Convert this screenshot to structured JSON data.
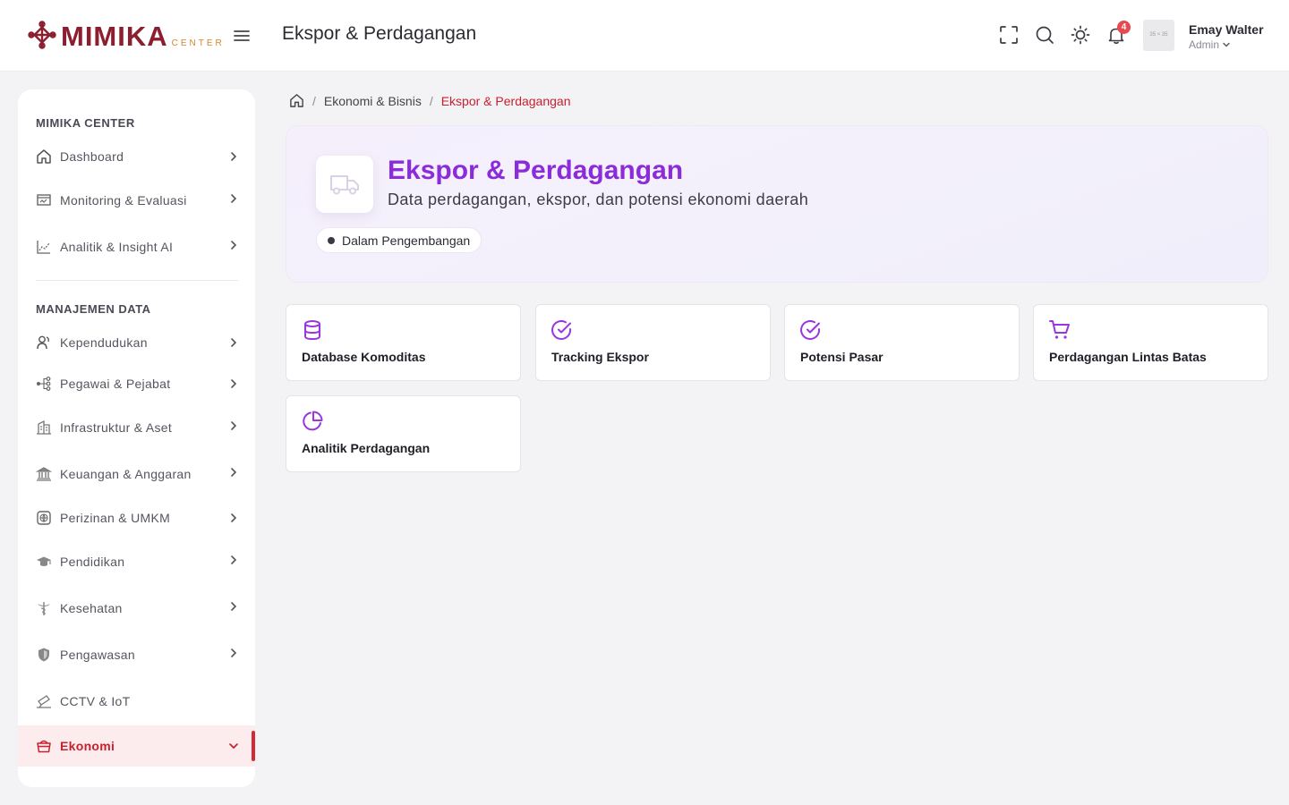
{
  "header": {
    "logo_text": "MIMIKA",
    "logo_sub": "CENTER",
    "title": "Ekspor & Perdagangan",
    "notification_count": "4",
    "avatar_placeholder": "35 × 35",
    "user_name": "Emay Walter",
    "user_role": "Admin",
    "icons": [
      "fullscreen-icon",
      "search-icon",
      "theme-sun-icon",
      "bell-icon"
    ]
  },
  "sidebar": {
    "section1": "MIMIKA CENTER",
    "section2": "MANAJEMEN DATA",
    "items1": [
      {
        "label": "Dashboard",
        "icon": "home-icon"
      },
      {
        "label": "Monitoring & Evaluasi",
        "icon": "monitor-icon"
      },
      {
        "label": "Analitik & Insight AI",
        "icon": "chart-icon"
      }
    ],
    "items2": [
      {
        "label": "Kependudukan",
        "icon": "users-icon"
      },
      {
        "label": "Pegawai & Pejabat",
        "icon": "org-chart-icon"
      },
      {
        "label": "Infrastruktur & Aset",
        "icon": "building-icon"
      },
      {
        "label": "Keuangan & Anggaran",
        "icon": "bank-icon"
      },
      {
        "label": "Perizinan & UMKM",
        "icon": "license-icon"
      },
      {
        "label": "Pendidikan",
        "icon": "graduation-cap-icon"
      },
      {
        "label": "Kesehatan",
        "icon": "caduceus-icon"
      },
      {
        "label": "Pengawasan",
        "icon": "shield-icon"
      },
      {
        "label": "CCTV & IoT",
        "icon": "camera-icon"
      },
      {
        "label": "Ekonomi",
        "icon": "basket-icon",
        "active": true
      }
    ]
  },
  "breadcrumb": {
    "parent": "Ekonomi & Bisnis",
    "current": "Ekspor & Perdagangan"
  },
  "hero": {
    "title": "Ekspor & Perdagangan",
    "subtitle": "Data perdagangan, ekspor, dan potensi ekonomi daerah",
    "status": "Dalam Pengembangan",
    "icon": "truck-icon"
  },
  "cards": [
    {
      "label": "Database Komoditas",
      "icon": "database-icon"
    },
    {
      "label": "Tracking Ekspor",
      "icon": "check-circle-icon"
    },
    {
      "label": "Potensi Pasar",
      "icon": "check-circle-icon"
    },
    {
      "label": "Perdagangan Lintas Batas",
      "icon": "cart-icon"
    },
    {
      "label": "Analitik Perdagangan",
      "icon": "pie-chart-icon"
    }
  ],
  "colors": {
    "brand": "#8b1e2f",
    "accent_purple": "#8b2bd9",
    "active_red": "#c8202e",
    "badge_red": "#e8484f"
  }
}
